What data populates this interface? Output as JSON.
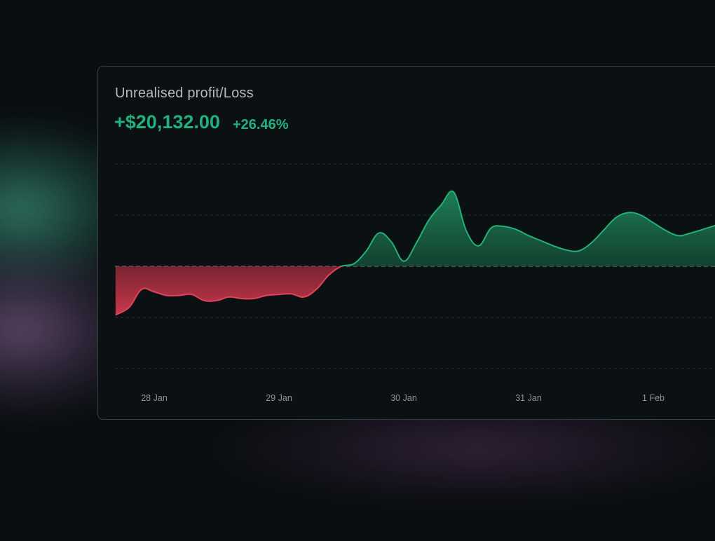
{
  "widget": {
    "title": "Unrealised profit/Loss",
    "value": "+$20,132.00",
    "change": "+26.46%"
  },
  "colors": {
    "positive": "#22b07d",
    "negative": "#e0435a",
    "text_muted": "#b4b9bc",
    "grid": "#2a3034"
  },
  "chart_data": {
    "type": "area",
    "x_ticks": [
      "28 Jan",
      "29 Jan",
      "30 Jan",
      "31 Jan",
      "1 Feb"
    ],
    "baseline": 0,
    "series": [
      {
        "x": [
          -0.31,
          -0.2,
          -0.1,
          0.0,
          0.1,
          0.2,
          0.3,
          0.4,
          0.5,
          0.6,
          0.7,
          0.8,
          0.9,
          1.0,
          1.1,
          1.2,
          1.3,
          1.4,
          1.5,
          1.6,
          1.7,
          1.8,
          1.9,
          2.0,
          2.1,
          2.2,
          2.3,
          2.4,
          2.5,
          2.6,
          2.7,
          2.8,
          2.9,
          3.0,
          3.1,
          3.2,
          3.3,
          3.4,
          3.5,
          3.6,
          3.7,
          3.8,
          3.9,
          4.0,
          4.1,
          4.2,
          4.3,
          4.5
        ],
        "values": [
          -0.95,
          -0.8,
          -0.45,
          -0.5,
          -0.57,
          -0.57,
          -0.55,
          -0.67,
          -0.67,
          -0.6,
          -0.63,
          -0.63,
          -0.57,
          -0.55,
          -0.54,
          -0.6,
          -0.45,
          -0.17,
          0.0,
          0.05,
          0.3,
          0.65,
          0.48,
          0.1,
          0.45,
          0.9,
          1.2,
          1.45,
          0.7,
          0.4,
          0.75,
          0.78,
          0.72,
          0.6,
          0.5,
          0.4,
          0.32,
          0.3,
          0.45,
          0.7,
          0.95,
          1.05,
          1.0,
          0.85,
          0.7,
          0.6,
          0.65,
          0.8
        ]
      }
    ],
    "grid": "dashed horizontal",
    "ylim": [
      -2,
      2
    ],
    "xlim": [
      -0.31,
      4.5
    ]
  }
}
